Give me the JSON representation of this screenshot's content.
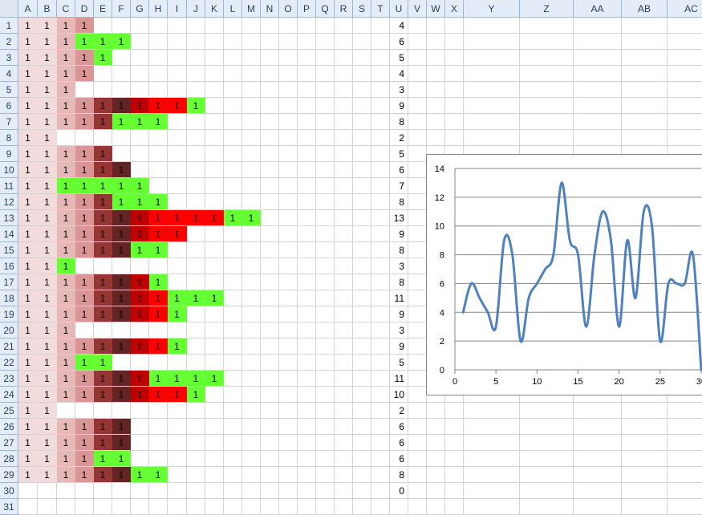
{
  "spreadsheet": {
    "columns": [
      "A",
      "B",
      "C",
      "D",
      "E",
      "F",
      "G",
      "H",
      "I",
      "J",
      "K",
      "L",
      "M",
      "N",
      "O",
      "P",
      "Q",
      "R",
      "S",
      "T",
      "U",
      "V",
      "W",
      "X",
      "Y",
      "Z",
      "AA",
      "AB",
      "AC"
    ],
    "rows": [
      "1",
      "2",
      "3",
      "4",
      "5",
      "6",
      "7",
      "8",
      "9",
      "10",
      "11",
      "12",
      "13",
      "14",
      "15",
      "16",
      "17",
      "18",
      "19",
      "20",
      "21",
      "22",
      "23",
      "24",
      "25",
      "26",
      "27",
      "28",
      "29",
      "30",
      "31"
    ],
    "cell_value": "1",
    "colors": {
      "pale_pink": "#f2dcdb",
      "pink": "#e6b8b7",
      "rose": "#da9694",
      "maroon": "#963634",
      "dark_maroon": "#632523",
      "dark_red": "#c00000",
      "red": "#ff0000",
      "green": "#66ff33"
    },
    "grid": [
      [
        "pale_pink",
        "pale_pink",
        "pink",
        "rose"
      ],
      [
        "pale_pink",
        "pale_pink",
        "pink",
        "green",
        "green",
        "green"
      ],
      [
        "pale_pink",
        "pale_pink",
        "pink",
        "rose",
        "green"
      ],
      [
        "pale_pink",
        "pale_pink",
        "pink",
        "rose"
      ],
      [
        "pale_pink",
        "pale_pink",
        "pink"
      ],
      [
        "pale_pink",
        "pale_pink",
        "pink",
        "rose",
        "maroon",
        "dark_maroon",
        "dark_red",
        "red",
        "red",
        "green"
      ],
      [
        "pale_pink",
        "pale_pink",
        "pink",
        "rose",
        "maroon",
        "green",
        "green",
        "green"
      ],
      [
        "pale_pink",
        "pale_pink"
      ],
      [
        "pale_pink",
        "pale_pink",
        "pink",
        "rose",
        "maroon"
      ],
      [
        "pale_pink",
        "pale_pink",
        "pink",
        "rose",
        "maroon",
        "dark_maroon"
      ],
      [
        "pale_pink",
        "pale_pink",
        "green",
        "green",
        "green",
        "green",
        "green"
      ],
      [
        "pale_pink",
        "pale_pink",
        "pink",
        "rose",
        "maroon",
        "green",
        "green",
        "green"
      ],
      [
        "pale_pink",
        "pale_pink",
        "pink",
        "rose",
        "maroon",
        "dark_maroon",
        "dark_red",
        "red",
        "red",
        "red",
        "red",
        "green",
        "green"
      ],
      [
        "pale_pink",
        "pale_pink",
        "pink",
        "rose",
        "maroon",
        "dark_maroon",
        "dark_red",
        "red",
        "red"
      ],
      [
        "pale_pink",
        "pale_pink",
        "pink",
        "rose",
        "maroon",
        "dark_maroon",
        "green",
        "green"
      ],
      [
        "pale_pink",
        "pale_pink",
        "green"
      ],
      [
        "pale_pink",
        "pale_pink",
        "pink",
        "rose",
        "maroon",
        "dark_maroon",
        "dark_red",
        "green"
      ],
      [
        "pale_pink",
        "pale_pink",
        "pink",
        "rose",
        "maroon",
        "dark_maroon",
        "dark_red",
        "red",
        "green",
        "green",
        "green"
      ],
      [
        "pale_pink",
        "pale_pink",
        "pink",
        "rose",
        "maroon",
        "dark_maroon",
        "dark_red",
        "red",
        "green"
      ],
      [
        "pale_pink",
        "pale_pink",
        "pink"
      ],
      [
        "pale_pink",
        "pale_pink",
        "pink",
        "rose",
        "maroon",
        "dark_maroon",
        "dark_red",
        "red",
        "green"
      ],
      [
        "pale_pink",
        "pale_pink",
        "pink",
        "green",
        "green"
      ],
      [
        "pale_pink",
        "pale_pink",
        "pink",
        "rose",
        "maroon",
        "dark_maroon",
        "dark_red",
        "green",
        "green",
        "green",
        "green"
      ],
      [
        "pale_pink",
        "pale_pink",
        "pink",
        "rose",
        "maroon",
        "dark_maroon",
        "dark_red",
        "red",
        "red",
        "green"
      ],
      [
        "pale_pink",
        "pale_pink"
      ],
      [
        "pale_pink",
        "pale_pink",
        "pink",
        "rose",
        "maroon",
        "dark_maroon"
      ],
      [
        "pale_pink",
        "pale_pink",
        "pink",
        "rose",
        "maroon",
        "dark_maroon"
      ],
      [
        "pale_pink",
        "pale_pink",
        "pink",
        "rose",
        "green",
        "green"
      ],
      [
        "pale_pink",
        "pale_pink",
        "pink",
        "rose",
        "maroon",
        "dark_maroon",
        "green",
        "green"
      ],
      [],
      []
    ],
    "column_u": [
      "4",
      "6",
      "5",
      "4",
      "3",
      "9",
      "8",
      "2",
      "5",
      "6",
      "7",
      "8",
      "13",
      "9",
      "8",
      "3",
      "8",
      "11",
      "9",
      "3",
      "9",
      "5",
      "11",
      "10",
      "2",
      "6",
      "6",
      "6",
      "8",
      "0",
      ""
    ]
  },
  "chart_data": {
    "type": "line",
    "smooth": true,
    "x": [
      1,
      2,
      3,
      4,
      5,
      6,
      7,
      8,
      9,
      10,
      11,
      12,
      13,
      14,
      15,
      16,
      17,
      18,
      19,
      20,
      21,
      22,
      23,
      24,
      25,
      26,
      27,
      28,
      29,
      30
    ],
    "series": [
      {
        "values": [
          4,
          6,
          5,
          4,
          3,
          9,
          8,
          2,
          5,
          6,
          7,
          8,
          13,
          9,
          8,
          3,
          8,
          11,
          9,
          3,
          9,
          5,
          11,
          10,
          2,
          6,
          6,
          6,
          8,
          0
        ],
        "color": "#4f81bd"
      }
    ],
    "xlim": [
      0,
      30
    ],
    "ylim": [
      0,
      14
    ],
    "xticks": [
      "0",
      "5",
      "10",
      "15",
      "20",
      "25",
      "30"
    ],
    "yticks": [
      "0",
      "2",
      "4",
      "6",
      "8",
      "10",
      "12",
      "14"
    ],
    "grid": "horizontal",
    "legend": "none"
  }
}
